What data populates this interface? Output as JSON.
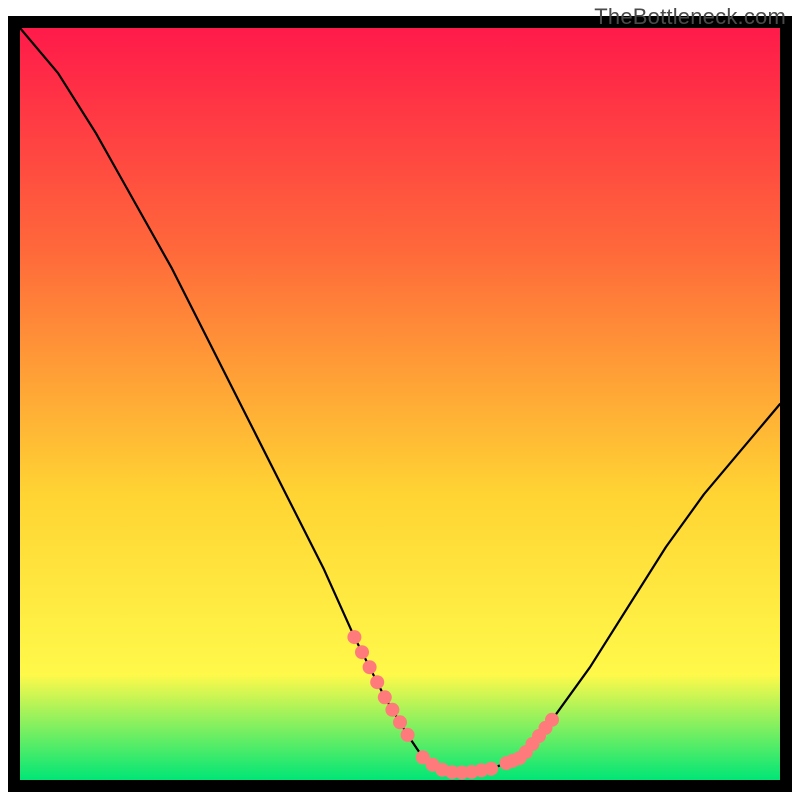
{
  "watermark": "TheBottleneck.com",
  "chart_data": {
    "type": "line",
    "title": "",
    "xlabel": "",
    "ylabel": "",
    "xlim": [
      0,
      100
    ],
    "ylim": [
      0,
      100
    ],
    "series": [
      {
        "name": "bottleneck-curve",
        "x": [
          0,
          5,
          10,
          15,
          20,
          25,
          30,
          35,
          40,
          44,
          48,
          51,
          53,
          55,
          57,
          59,
          62,
          66,
          70,
          75,
          80,
          85,
          90,
          95,
          100
        ],
        "y": [
          100,
          94,
          86,
          77,
          68,
          58,
          48,
          38,
          28,
          19,
          11,
          6,
          3,
          1.5,
          1,
          1,
          1.5,
          3,
          8,
          15,
          23,
          31,
          38,
          44,
          50
        ]
      }
    ],
    "highlight_segments": [
      {
        "name": "left-dots",
        "x_start": 44,
        "x_end": 51,
        "count": 8
      },
      {
        "name": "valley-dots",
        "x_start": 53,
        "x_end": 62,
        "count": 8
      },
      {
        "name": "right-dots",
        "x_start": 64,
        "x_end": 70,
        "count": 8
      }
    ],
    "background_gradient": {
      "top": "#ff1a4a",
      "upper_mid": "#ff6a3a",
      "mid": "#ffd433",
      "lower_mid": "#fff94a",
      "bottom": "#00e676"
    },
    "frame_color": "#000000",
    "curve_color": "#000000",
    "dot_color": "#ff7b7b"
  }
}
